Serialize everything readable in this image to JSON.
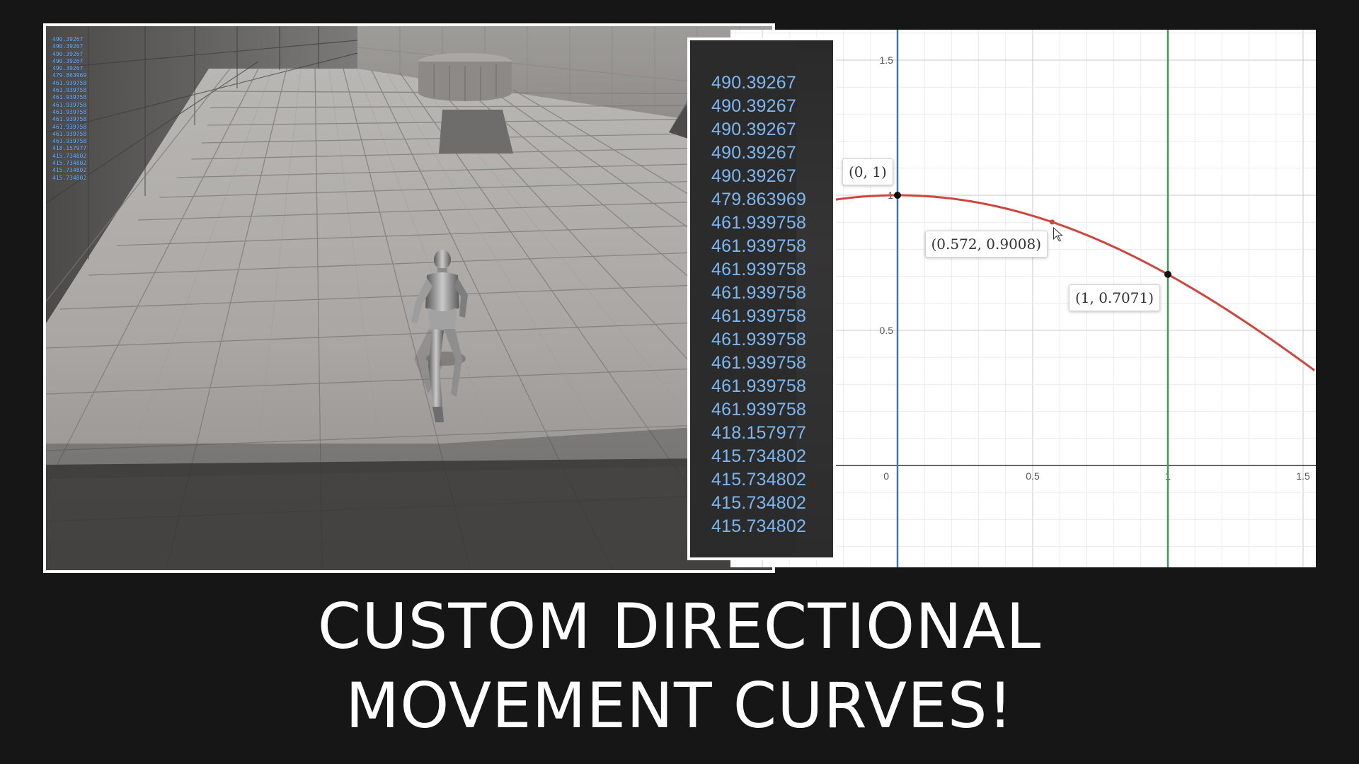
{
  "viewport": {
    "debug_values": [
      "490.39267",
      "490.39267",
      "490.39267",
      "490.39267",
      "490.39267",
      "479.863969",
      "461.939758",
      "461.939758",
      "461.939758",
      "461.939758",
      "461.939758",
      "461.939758",
      "461.939758",
      "461.939758",
      "461.939758",
      "418.157977",
      "415.734802",
      "415.734802",
      "415.734802",
      "415.734802"
    ]
  },
  "zoom_panel": {
    "values": [
      "490.39267",
      "490.39267",
      "490.39267",
      "490.39267",
      "490.39267",
      "479.863969",
      "461.939758",
      "461.939758",
      "461.939758",
      "461.939758",
      "461.939758",
      "461.939758",
      "461.939758",
      "461.939758",
      "461.939758",
      "418.157977",
      "415.734802",
      "415.734802",
      "415.734802",
      "415.734802"
    ],
    "text_color": "#7db7f0"
  },
  "graph": {
    "x_ticks": [
      "0",
      "0.5",
      "1",
      "1.5"
    ],
    "y_ticks": [
      "0.5",
      "1",
      "1.5"
    ],
    "curve_color": "#d0443b",
    "blue_line_color": "#3b78b4",
    "green_line_color": "#3d9a4f",
    "points": [
      {
        "label": "(0, 1)",
        "x": 0,
        "y": 1
      },
      {
        "label": "(0.572, 0.9008)",
        "x": 0.572,
        "y": 0.9008
      },
      {
        "label": "(1, 0.7071)",
        "x": 1,
        "y": 0.7071
      }
    ]
  },
  "title": {
    "line1": "CUSTOM DIRECTIONAL",
    "line2": "MOVEMENT CURVES!"
  }
}
